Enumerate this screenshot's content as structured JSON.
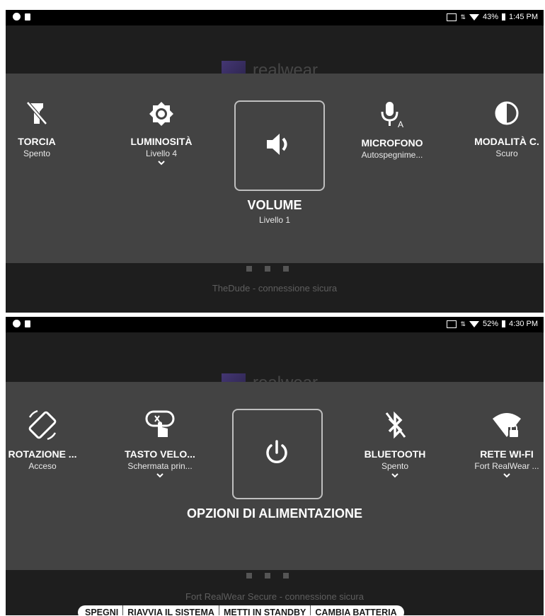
{
  "screen1": {
    "status": {
      "battery": "43%",
      "time": "1:45 PM"
    },
    "logo_text": "realwear",
    "tiles": [
      {
        "label": "TORCIA",
        "sub": "Spento"
      },
      {
        "label": "LUMINOSITÀ",
        "sub": "Livello 4"
      },
      {
        "label": "MICROFONO",
        "sub": "Autospegnime..."
      },
      {
        "label": "MODALITÀ C.",
        "sub": "Scuro"
      }
    ],
    "focused": {
      "label": "VOLUME",
      "sub": "Livello 1"
    },
    "connection": "TheDude - connessione sicura"
  },
  "screen2": {
    "status": {
      "battery": "52%",
      "time": "4:30 PM"
    },
    "logo_text": "realwear",
    "tiles": [
      {
        "label": "ROTAZIONE ...",
        "sub": "Acceso"
      },
      {
        "label": "TASTO VELO...",
        "sub": "Schermata prin..."
      },
      {
        "label": "BLUETOOTH",
        "sub": "Spento"
      },
      {
        "label": "RETE WI-FI",
        "sub": "Fort RealWear ..."
      }
    ],
    "focused": {
      "label": "OPZIONI DI ALIMENTAZIONE"
    },
    "options": [
      "SPEGNI",
      "RIAVVIA IL SISTEMA",
      "METTI IN STANDBY",
      "CAMBIA BATTERIA"
    ],
    "connection": "Fort RealWear Secure - connessione sicura"
  },
  "icons": {
    "flashlight": "flashlight-off-icon",
    "brightness": "brightness-icon",
    "volume": "volume-icon",
    "microphone": "microphone-auto-icon",
    "theme": "contrast-icon",
    "rotation": "screen-rotation-icon",
    "shortcut": "touch-shortcut-icon",
    "power": "power-icon",
    "bluetooth": "bluetooth-off-icon",
    "wifi": "wifi-lock-icon"
  },
  "colors": {
    "panel": "#434343",
    "background": "#1e1e1e",
    "statusbar": "#000000"
  }
}
